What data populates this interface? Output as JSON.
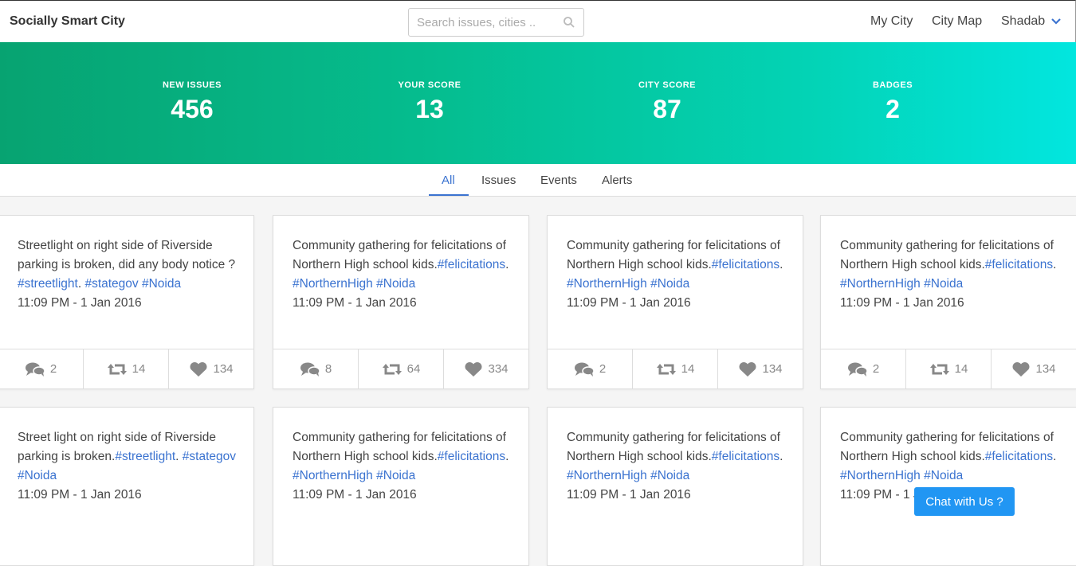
{
  "header": {
    "brand": "Socially Smart City",
    "search_placeholder": "Search issues, cities ..",
    "nav": {
      "my_city": "My City",
      "city_map": "City Map",
      "user": "Shadab"
    }
  },
  "stats": [
    {
      "label": "NEW ISSUES",
      "value": "456"
    },
    {
      "label": "YOUR SCORE",
      "value": "13"
    },
    {
      "label": "CITY SCORE",
      "value": "87"
    },
    {
      "label": "BADGES",
      "value": "2"
    }
  ],
  "tabs": [
    "All",
    "Issues",
    "Events",
    "Alerts"
  ],
  "active_tab": "All",
  "cards": [
    {
      "pre": "Streetlight on right side of Riverside parking is broken, did any body notice ?",
      "mid": "",
      "tags": [
        "#streetlight",
        "#stategov",
        "#Noida"
      ],
      "time": "11:09 PM - 1 Jan 2016",
      "comments": "2",
      "retweets": "14",
      "likes": "134"
    },
    {
      "pre": "Community gathering for felicitations of Northern High school kids.",
      "mid": "",
      "tags": [
        "#felicitations",
        "#NorthernHigh",
        "#Noida"
      ],
      "time": "11:09 PM - 1 Jan 2016",
      "comments": "8",
      "retweets": "64",
      "likes": "334"
    },
    {
      "pre": "Community gathering for felicitations of Northern High school kids.",
      "mid": "",
      "tags": [
        "#felicitations",
        "#NorthernHigh",
        "#Noida"
      ],
      "time": "11:09 PM - 1 Jan 2016",
      "comments": "2",
      "retweets": "14",
      "likes": "134"
    },
    {
      "pre": "Community gathering for felicitations of Northern High school kids.",
      "mid": "",
      "tags": [
        "#felicitations",
        "#NorthernHigh",
        "#Noida"
      ],
      "time": "11:09 PM - 1 Jan 2016",
      "comments": "2",
      "retweets": "14",
      "likes": "134"
    },
    {
      "pre": "Street light on right side of Riverside parking is broken.",
      "mid": "",
      "tags": [
        "#streetlight",
        "#stategov",
        "#Noida"
      ],
      "time": "11:09 PM - 1 Jan 2016"
    },
    {
      "pre": "Community gathering for felicitations of Northern High school kids.",
      "mid": "",
      "tags": [
        "#felicitations",
        "#NorthernHigh",
        "#Noida"
      ],
      "time": "11:09 PM - 1 Jan 2016"
    },
    {
      "pre": "Community gathering for felicitations of Northern High school kids.",
      "mid": "",
      "tags": [
        "#felicitations",
        "#NorthernHigh",
        "#Noida"
      ],
      "time": "11:09 PM - 1 Jan 2016"
    },
    {
      "pre": "Community gathering for felicitations of Northern High school kids.",
      "mid": "",
      "tags": [
        "#felicitations",
        "#NorthernHigh",
        "#Noida"
      ],
      "time": "11:09 PM - 1 Jan 2016"
    }
  ],
  "chat_label": "Chat with Us ?",
  "colors": {
    "accent": "#3b73d0",
    "hero_start": "#07a371",
    "hero_end": "#02e6df",
    "chat": "#2196f3"
  }
}
